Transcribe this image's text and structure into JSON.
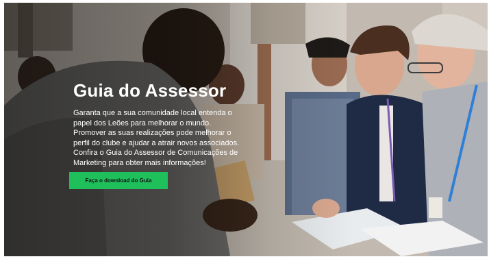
{
  "hero": {
    "title": "Guia do Assessor",
    "paragraph": "Garanta que a sua comunidade local entenda o papel dos Leões para melhorar o mundo. Promover as suas realizações pode melhorar o perfil do clube e ajudar a atrair novos associados. Confira o Guia do Assessor de Comunicações de Marketing para obter mais informações!",
    "cta_label": "Faça o download do Guia"
  },
  "colors": {
    "cta_background": "#1fbf5c",
    "title_text": "#ffffff"
  }
}
